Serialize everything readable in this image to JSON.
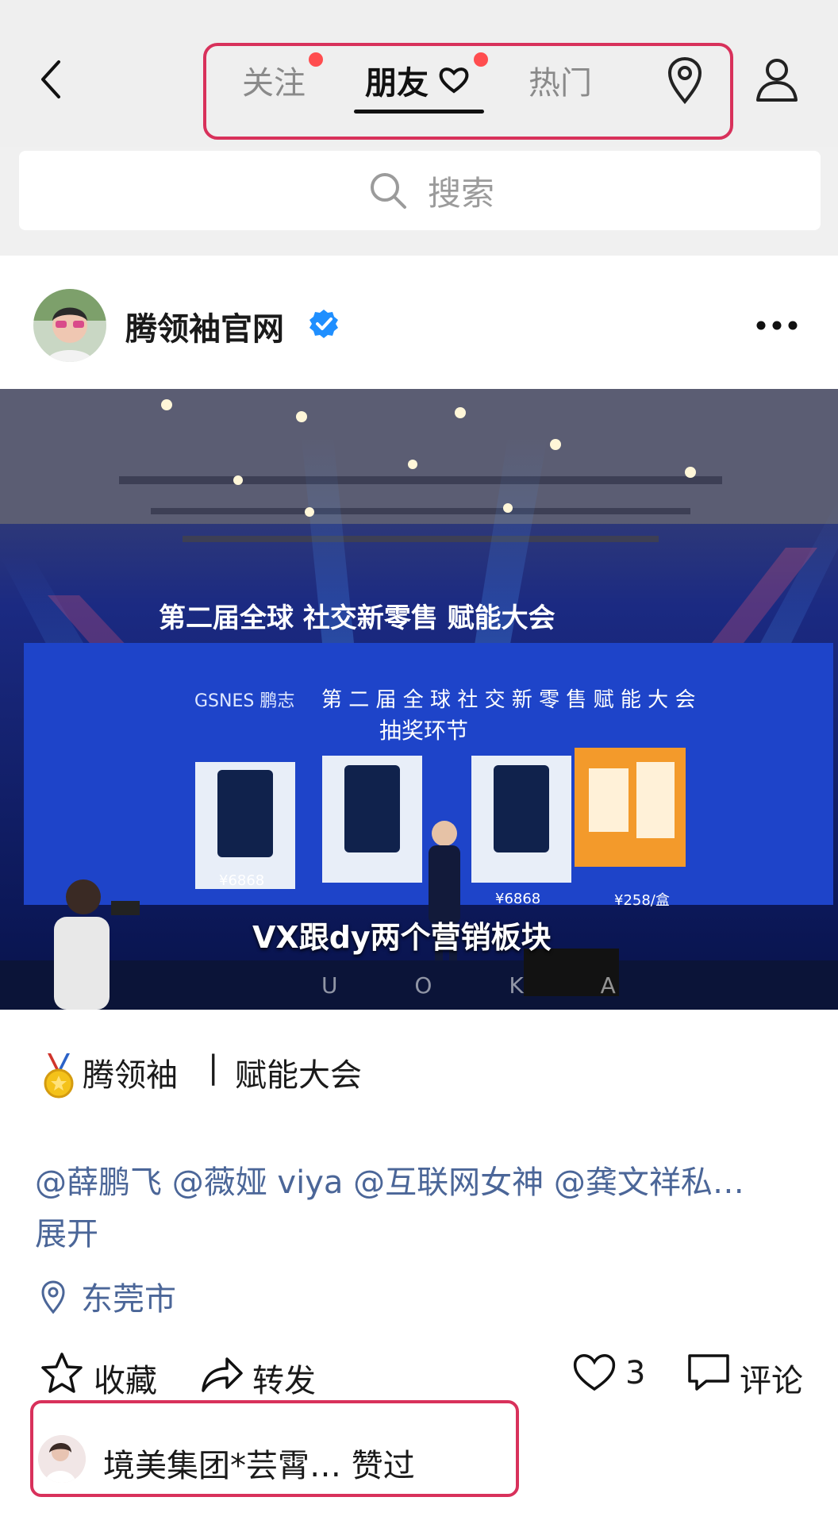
{
  "nav": {
    "tabs": [
      "关注",
      "朋友",
      "热门"
    ],
    "active_tab": "朋友"
  },
  "search": {
    "placeholder": "搜索"
  },
  "post": {
    "author": "腾领袖官网",
    "video_caption": "VX跟dy两个营销板块",
    "watermark": "U O K A",
    "title_main": "腾领袖",
    "title_sep": "|",
    "title_sub": "赋能大会",
    "mentions": "@薛鹏飞 @薇娅 viya @互联网女神 @龚文祥私…",
    "expand": "展开",
    "location": "东莞市",
    "actions": {
      "collect": "收藏",
      "share": "转发",
      "likes": "3",
      "comment": "评论"
    },
    "liked_by": "境美集团*芸霄… 赞过"
  },
  "colors": {
    "highlight": "#d8315b",
    "link": "#4b6698",
    "badge": "#1f8fff"
  }
}
